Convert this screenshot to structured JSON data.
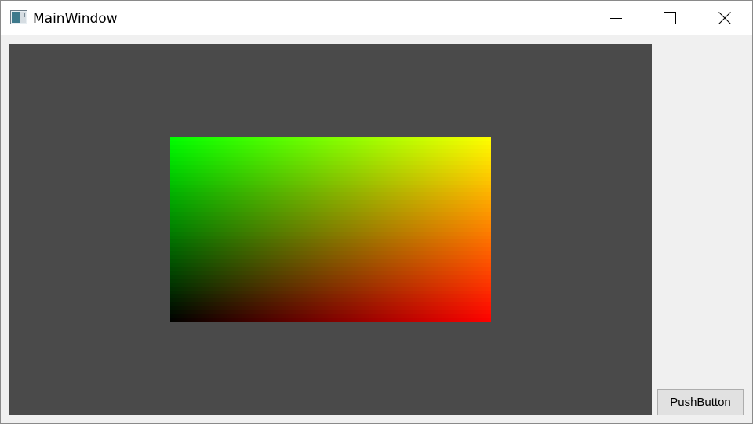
{
  "window": {
    "title": "MainWindow",
    "icon": "app-window-icon",
    "controls": [
      "minimize-icon",
      "maximize-icon",
      "close-icon"
    ]
  },
  "canvas": {
    "background": "#4a4a4a",
    "gradient": {
      "top_left": "#00ff00",
      "top_right": "#ffff00",
      "bottom_left": "#000000",
      "bottom_right": "#ff0000"
    }
  },
  "button": {
    "label": "PushButton"
  }
}
